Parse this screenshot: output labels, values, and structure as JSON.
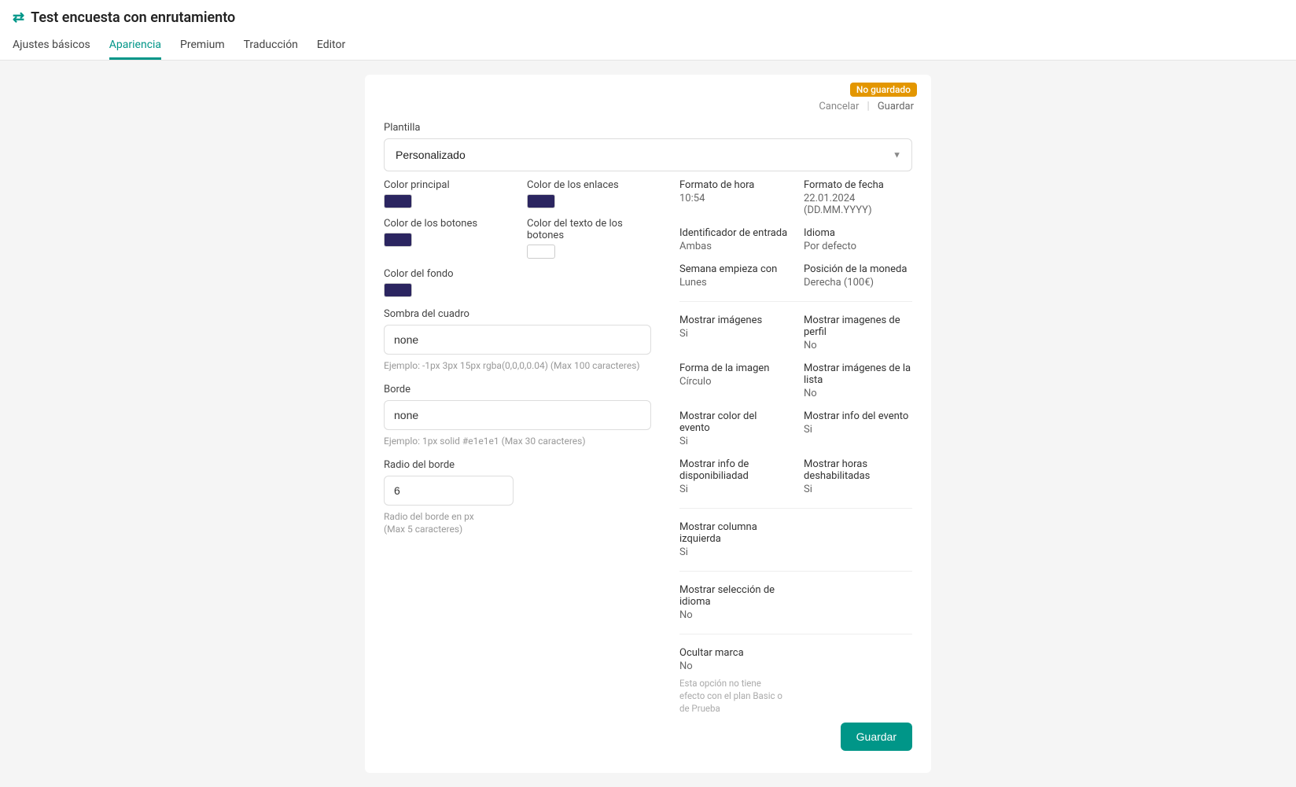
{
  "header": {
    "title": "Test encuesta con enrutamiento",
    "tabs": [
      "Ajustes básicos",
      "Apariencia",
      "Premium",
      "Traducción",
      "Editor"
    ],
    "activeTab": 1
  },
  "actions": {
    "unsaved_badge": "No guardado",
    "cancel": "Cancelar",
    "save_link": "Guardar",
    "save_button": "Guardar"
  },
  "template": {
    "label": "Plantilla",
    "value": "Personalizado"
  },
  "colors": {
    "main_label": "Color principal",
    "main_value": "#2b2560",
    "link_label": "Color de los enlaces",
    "link_value": "#2b2560",
    "button_label": "Color de los botones",
    "button_value": "#2b2560",
    "button_text_label": "Color del texto de los botones",
    "button_text_value": "#ffffff",
    "bg_label": "Color del fondo",
    "bg_value": "#2b2560"
  },
  "shadow": {
    "label": "Sombra del cuadro",
    "value": "none",
    "help": "Ejemplo: -1px 3px 15px rgba(0,0,0,0.04) (Max 100 caracteres)"
  },
  "border": {
    "label": "Borde",
    "value": "none",
    "help": "Ejemplo: 1px solid #e1e1e1 (Max 30 caracteres)"
  },
  "radius": {
    "label": "Radio del borde",
    "value": "6",
    "help": "Radio del borde en px (Max 5 caracteres)"
  },
  "info": {
    "time_format": {
      "label": "Formato de hora",
      "value": "10:54"
    },
    "date_format": {
      "label": "Formato de fecha",
      "value": "22.01.2024 (DD.MM.YYYY)"
    },
    "entry_id": {
      "label": "Identificador de entrada",
      "value": "Ambas"
    },
    "language": {
      "label": "Idioma",
      "value": "Por defecto"
    },
    "week_start": {
      "label": "Semana empieza con",
      "value": "Lunes"
    },
    "currency_pos": {
      "label": "Posición de la moneda",
      "value": "Derecha (100€)"
    },
    "show_images": {
      "label": "Mostrar imágenes",
      "value": "Si"
    },
    "show_profile_images": {
      "label": "Mostrar imagenes de perfil",
      "value": "No"
    },
    "image_shape": {
      "label": "Forma de la imagen",
      "value": "Círculo"
    },
    "show_list_images": {
      "label": "Mostrar imágenes de la lista",
      "value": "No"
    },
    "show_event_color": {
      "label": "Mostrar color del evento",
      "value": "Si"
    },
    "show_event_info": {
      "label": "Mostrar info del evento",
      "value": "Si"
    },
    "show_avail_info": {
      "label": "Mostrar info de disponibiliadad",
      "value": "Si"
    },
    "show_disabled_hours": {
      "label": "Mostrar horas deshabilitadas",
      "value": "Si"
    },
    "show_left_col": {
      "label": "Mostrar columna izquierda",
      "value": "Si"
    },
    "show_lang_select": {
      "label": "Mostrar selección de idioma",
      "value": "No"
    },
    "hide_brand": {
      "label": "Ocultar marca",
      "value": "No",
      "help": "Esta opción no tiene efecto con el plan Basic o de Prueba"
    }
  }
}
